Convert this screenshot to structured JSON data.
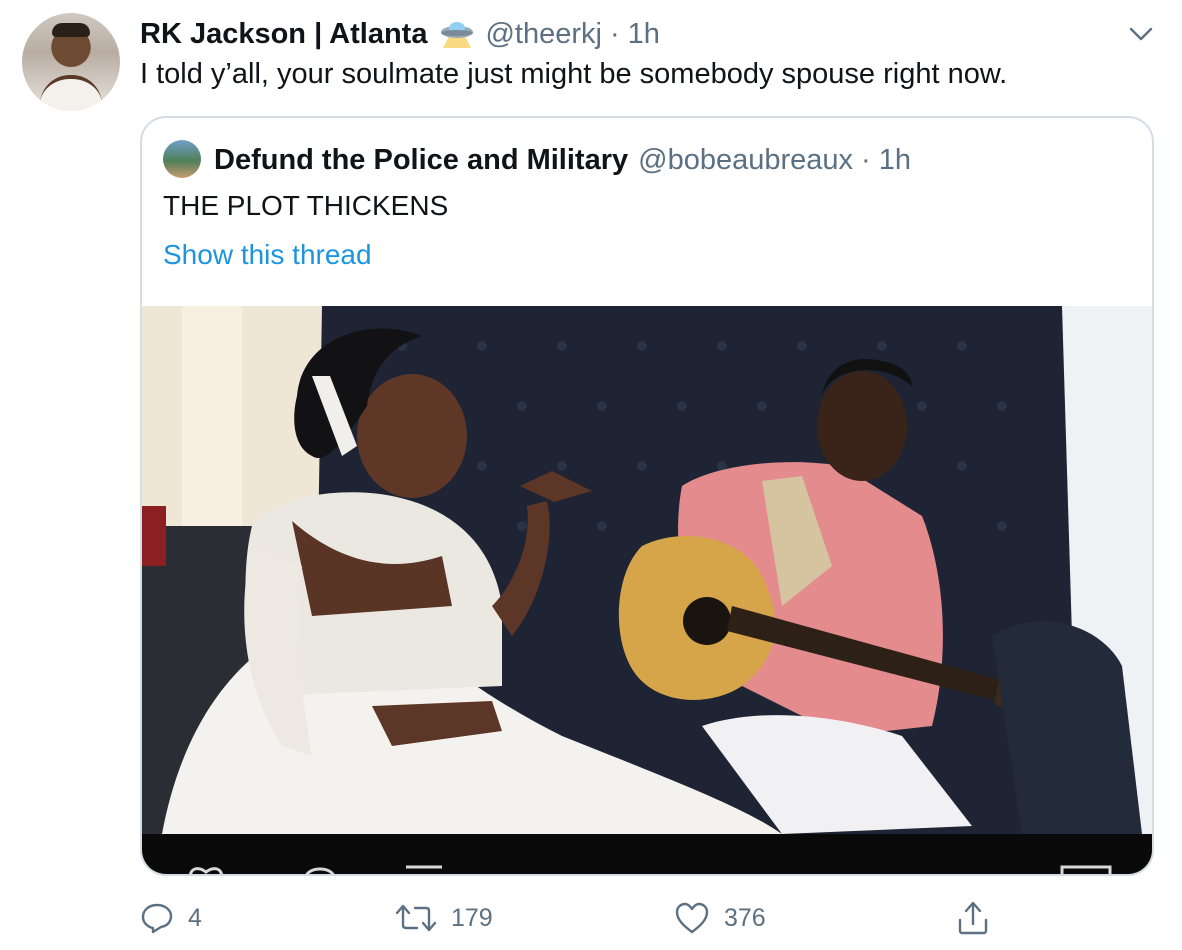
{
  "tweet": {
    "author_name": "RK Jackson | Atlanta",
    "author_badge": "ufo-emoji",
    "handle": "@theerkj",
    "separator": "·",
    "time": "1h",
    "text": "I told y’all, your soulmate just might be somebody spouse right now."
  },
  "quoted": {
    "author_name": "Defund the Police and Military",
    "handle": "@bobeaubreaux",
    "separator": "·",
    "time": "1h",
    "text": "THE PLOT THICKENS",
    "thread_link": "Show this thread",
    "media_type": "video"
  },
  "actions": {
    "reply_count": "4",
    "retweet_count": "179",
    "like_count": "376"
  },
  "colors": {
    "link": "#1b95e0",
    "secondary_text": "#5b7083",
    "border": "#d3dde4"
  }
}
